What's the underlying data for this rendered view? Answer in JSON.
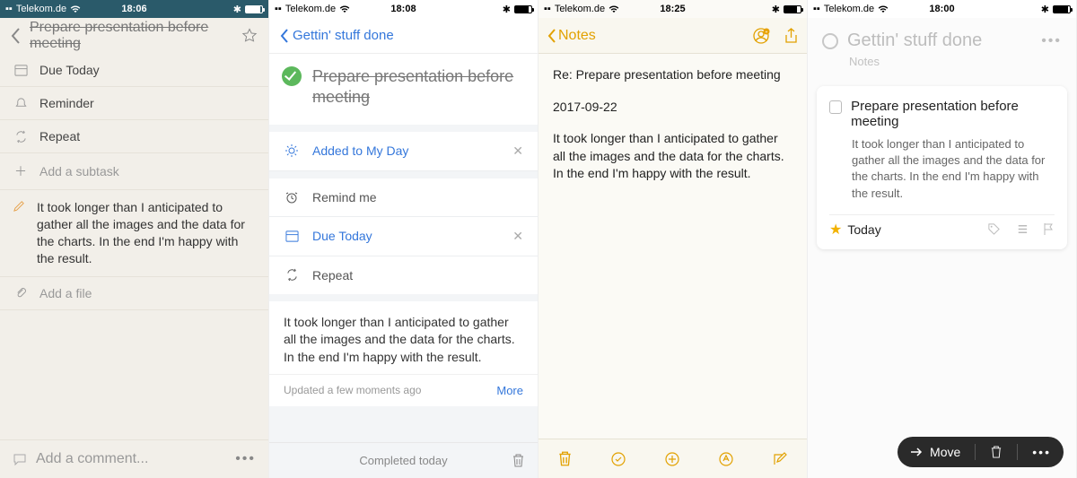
{
  "common": {
    "carrier": "Telekom.de"
  },
  "panelA": {
    "time": "18:06",
    "title": "Prepare presentation before meeting",
    "rows": {
      "due": "Due Today",
      "reminder": "Reminder",
      "repeat": "Repeat",
      "subtask": "Add a subtask",
      "note": "It took longer than I anticipated to gather all the images and the data for the charts. In the end I'm happy with the result.",
      "file": "Add a file"
    },
    "footer": {
      "comment": "Add a comment..."
    }
  },
  "panelB": {
    "time": "18:08",
    "back": "Gettin' stuff done",
    "title": "Prepare presentation before meeting",
    "items": {
      "myday": "Added to My Day",
      "remind": "Remind me",
      "due": "Due Today",
      "repeat": "Repeat"
    },
    "note": "It took longer than I anticipated to gather all the images and the data for the charts. In the end I'm happy with the result.",
    "updated": "Updated a few moments ago",
    "more": "More",
    "footer": "Completed today"
  },
  "panelC": {
    "time": "18:25",
    "back": "Notes",
    "title": "Re: Prepare presentation before meeting",
    "date": "2017-09-22",
    "body": "It took longer than I anticipated to gather all the images and the data for the charts. In the end I'm happy with the result."
  },
  "panelD": {
    "time": "18:00",
    "header": "Gettin' stuff done",
    "sub": "Notes",
    "task": "Prepare presentation before meeting",
    "desc": "It took longer than I anticipated to gather all the images and the data for the charts. In the end I'm happy with the result.",
    "tag": "Today",
    "move": "Move"
  }
}
